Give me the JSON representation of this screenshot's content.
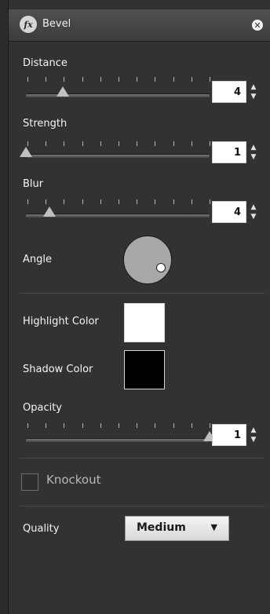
{
  "title_bar": {
    "fx_label": "fx",
    "title": "Bevel",
    "close_icon": "close-icon"
  },
  "sliders": [
    {
      "id": "distance",
      "label": "Distance",
      "value": "4",
      "fraction": 0.2
    },
    {
      "id": "strength",
      "label": "Strength",
      "value": "1",
      "fraction": 0.0
    },
    {
      "id": "blur",
      "label": "Blur",
      "value": "4",
      "fraction": 0.13
    }
  ],
  "angle": {
    "label": "Angle"
  },
  "colors": {
    "highlight": {
      "label": "Highlight Color",
      "color": "#ffffff"
    },
    "shadow": {
      "label": "Shadow Color",
      "color": "#000000"
    }
  },
  "opacity": {
    "label": "Opacity",
    "value": "1",
    "fraction": 1.0
  },
  "knockout": {
    "label": "Knockout",
    "checked": false
  },
  "quality": {
    "label": "Quality",
    "value": "Medium"
  },
  "icons": {
    "stepper_up": "triangle-up-icon",
    "stepper_down": "triangle-down-icon",
    "dropdown": "triangle-down-icon"
  }
}
